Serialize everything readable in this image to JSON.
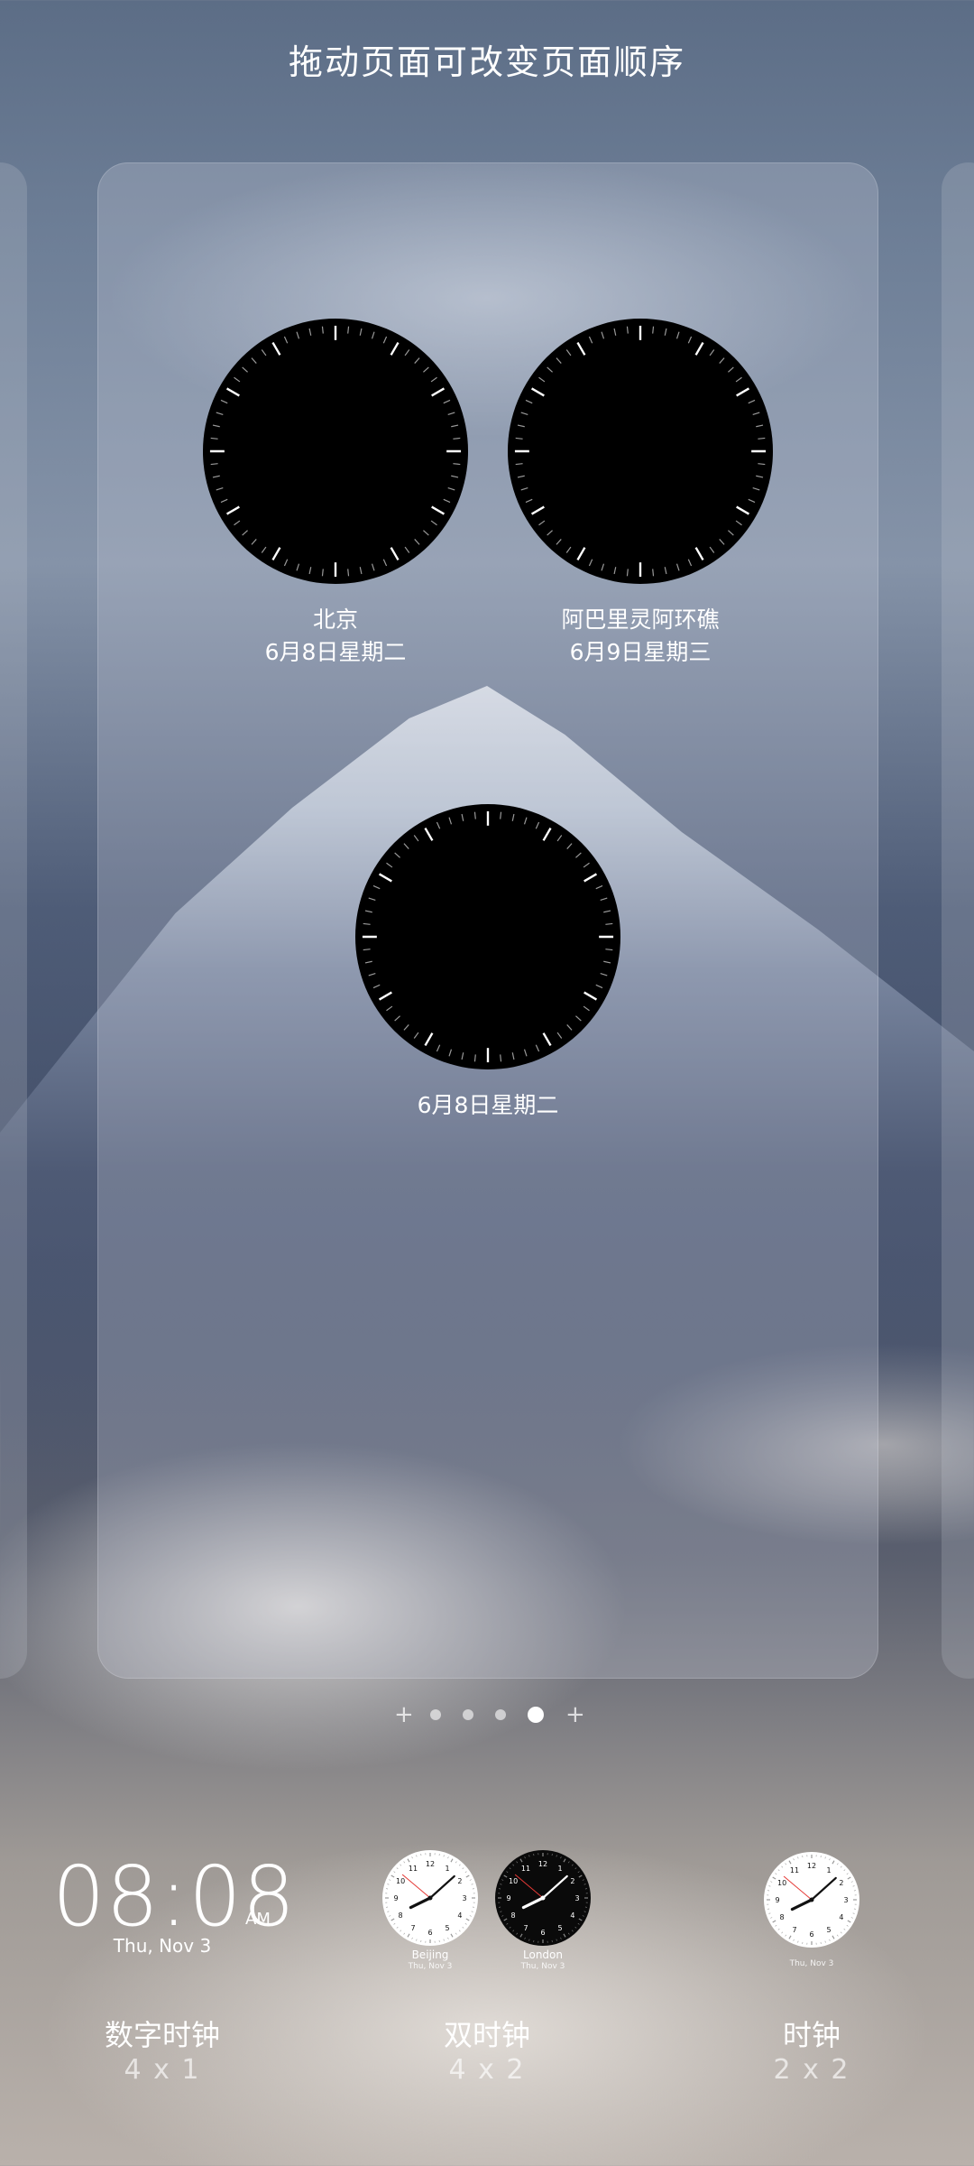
{
  "header": {
    "title": "拖动页面可改变页面顺序"
  },
  "page": {
    "clocks": [
      {
        "city": "北京",
        "date": "6月8日星期二"
      },
      {
        "city": "阿巴里灵阿环礁",
        "date": "6月9日星期三"
      },
      {
        "city": "",
        "date": "6月8日星期二"
      }
    ]
  },
  "pager": {
    "count": 4,
    "active_index": 3
  },
  "widgets": {
    "digital": {
      "time": "08:08",
      "ampm": "AM",
      "date": "Thu, Nov 3",
      "name": "数字时钟",
      "size": "4 x 1"
    },
    "dual": {
      "clock1": {
        "city": "Beijing",
        "date": "Thu, Nov 3"
      },
      "clock2": {
        "city": "London",
        "date": "Thu, Nov 3"
      },
      "name": "双时钟",
      "size": "4 x 2"
    },
    "analog": {
      "date": "Thu, Nov 3",
      "name": "时钟",
      "size": "2 x 2"
    }
  },
  "colors": {
    "clock_face": "#000000",
    "tick": "#ffffff",
    "second_hand": "#e53935"
  }
}
